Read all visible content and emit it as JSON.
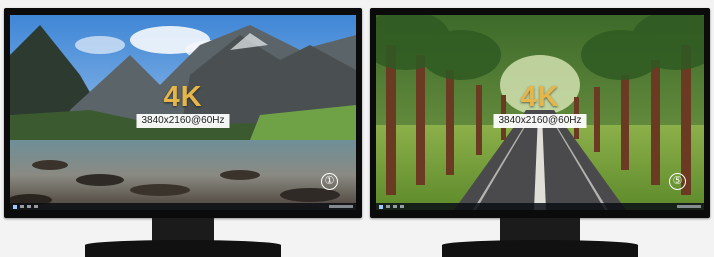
{
  "monitors": [
    {
      "id": "monitor-left",
      "scene": "mountain-lake",
      "badge": "4K",
      "resolution": "3840x2160@60Hz",
      "number": "①"
    },
    {
      "id": "monitor-right",
      "scene": "tree-lined-road",
      "badge": "4K",
      "resolution": "3840x2160@60Hz",
      "number": "⑤"
    }
  ],
  "colors": {
    "badge": "#e7b64a",
    "bezel": "#0b0b0c",
    "background": "#f3f3f4"
  }
}
